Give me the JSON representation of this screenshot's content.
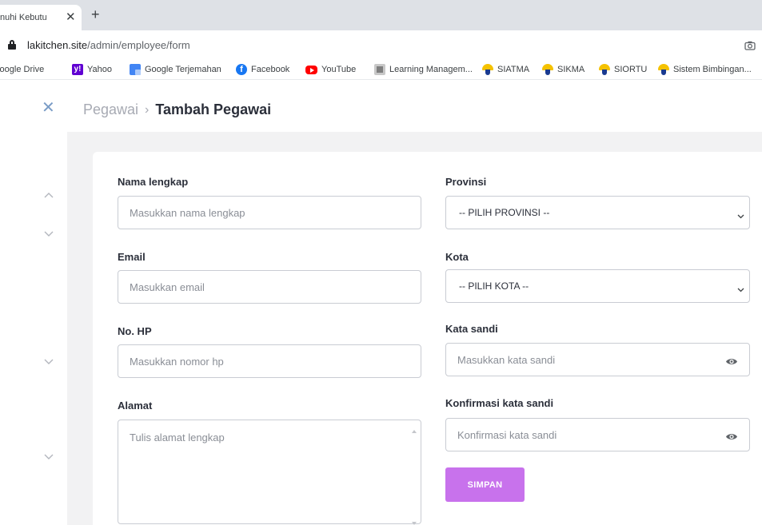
{
  "browser": {
    "tab_title": "nuhi Kebutu",
    "new_tab_label": "+",
    "tab_close_label": "✕",
    "url_host": "lakitchen.site",
    "url_path": "/admin/employee/form",
    "bookmarks": [
      {
        "label": "Google Drive",
        "icon": "google-drive-icon"
      },
      {
        "label": "Yahoo",
        "icon": "yahoo-icon"
      },
      {
        "label": "Google Terjemahan",
        "icon": "google-translate-icon"
      },
      {
        "label": "Facebook",
        "icon": "facebook-icon"
      },
      {
        "label": "YouTube",
        "icon": "youtube-icon"
      },
      {
        "label": "Learning Managem...",
        "icon": "learning-management-icon"
      },
      {
        "label": "SIATMA",
        "icon": "atma-icon"
      },
      {
        "label": "SIKMA",
        "icon": "atma-icon"
      },
      {
        "label": "SIORTU",
        "icon": "atma-icon"
      },
      {
        "label": "Sistem Bimbingan...",
        "icon": "atma-icon"
      }
    ]
  },
  "header": {
    "close_symbol": "✕",
    "breadcrumb_root": "Pegawai",
    "breadcrumb_separator": "›",
    "breadcrumb_current": "Tambah Pegawai"
  },
  "form": {
    "nama": {
      "label": "Nama lengkap",
      "placeholder": "Masukkan nama lengkap",
      "value": ""
    },
    "email": {
      "label": "Email",
      "placeholder": "Masukkan email",
      "value": ""
    },
    "hp": {
      "label": "No. HP",
      "placeholder": "Masukkan nomor hp",
      "value": ""
    },
    "alamat": {
      "label": "Alamat",
      "placeholder": "Tulis alamat lengkap",
      "value": ""
    },
    "provinsi": {
      "label": "Provinsi",
      "selected": "-- PILIH PROVINSI --"
    },
    "kota": {
      "label": "Kota",
      "selected": "-- PILIH KOTA --"
    },
    "sandi": {
      "label": "Kata sandi",
      "placeholder": "Masukkan kata sandi",
      "value": ""
    },
    "konfirmasi": {
      "label": "Konfirmasi kata sandi",
      "placeholder": "Konfirmasi kata sandi",
      "value": ""
    },
    "submit_label": "SIMPAN"
  },
  "colors": {
    "accent_button": "#c872ec",
    "close_icon": "#7a9cc6",
    "page_bg_gray": "#f2f2f3"
  }
}
